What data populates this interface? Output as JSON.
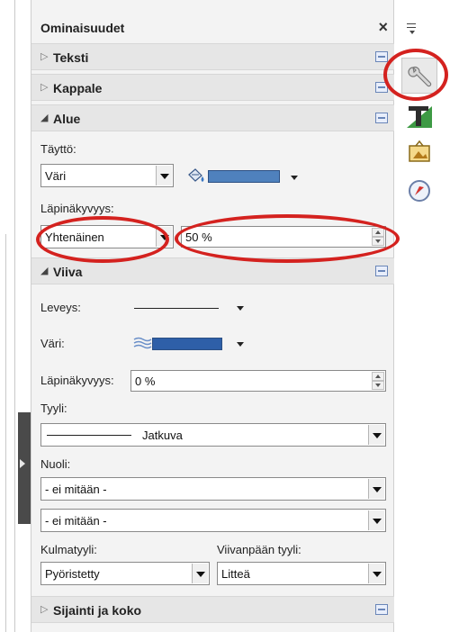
{
  "panel": {
    "title": "Ominaisuudet",
    "close_symbol": "×",
    "sections": {
      "teksti": "Teksti",
      "kappale": "Kappale",
      "alue": "Alue",
      "viiva": "Viiva",
      "sijainti": "Sijainti ja koko"
    }
  },
  "alue": {
    "fill_label": "Täyttö:",
    "fill_value": "Väri",
    "fill_color": "#4f81bd",
    "transparency_label": "Läpinäkyvyys:",
    "transparency_mode": "Yhtenäinen",
    "transparency_value": "50 %"
  },
  "viiva": {
    "width_label": "Leveys:",
    "color_label": "Väri:",
    "line_color": "#2e5fa8",
    "transparency_label": "Läpinäkyvyys:",
    "transparency_value": "0 %",
    "style_label": "Tyyli:",
    "style_value": "Jatkuva",
    "arrow_label": "Nuoli:",
    "arrow_start": "- ei mitään -",
    "arrow_end": "- ei mitään -",
    "corner_label": "Kulmatyyli:",
    "corner_value": "Pyöristetty",
    "cap_label": "Viivanpään tyyli:",
    "cap_value": "Litteä"
  },
  "sidebar_tabs": [
    "menu-icon",
    "properties-wrench-icon",
    "styles-icon",
    "gallery-icon",
    "navigator-icon"
  ],
  "annotation_color": "#d4221f"
}
